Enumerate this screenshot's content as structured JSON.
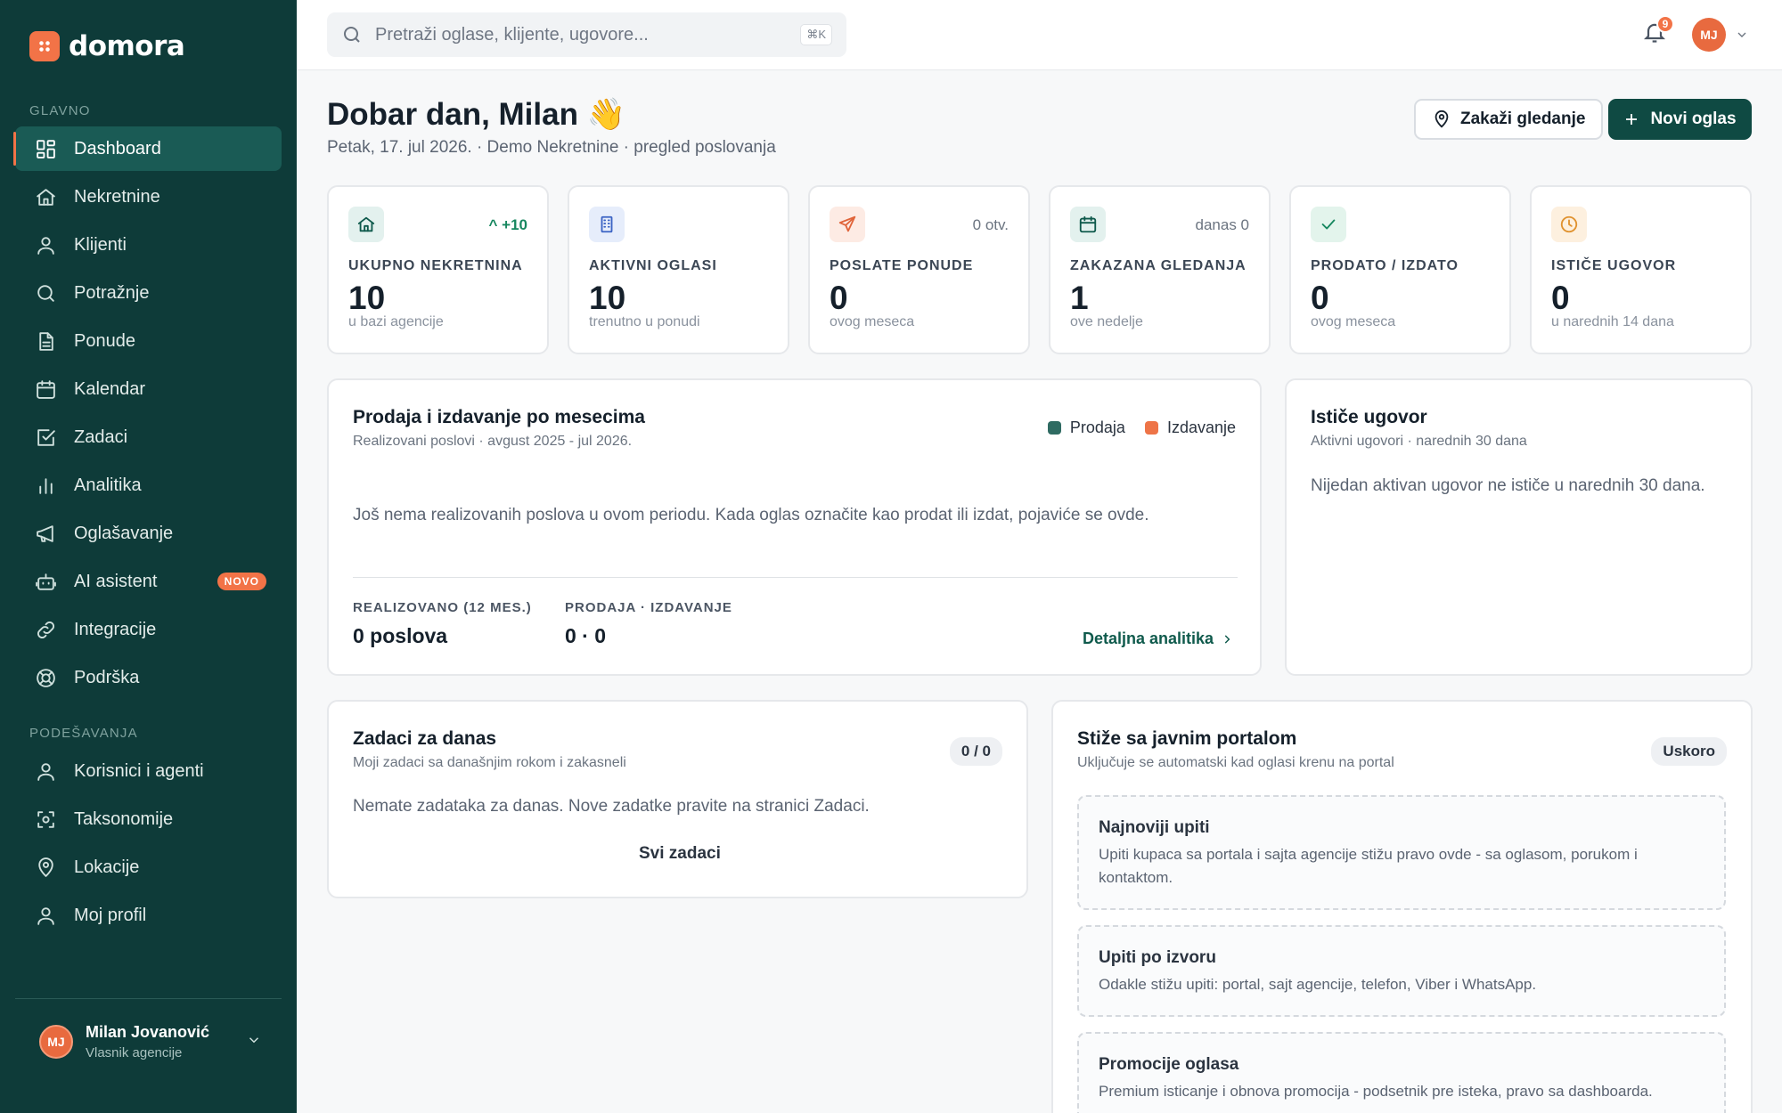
{
  "brand": {
    "name": "domora",
    "accent": "#f27347",
    "sidebar_bg": "#0e3b39",
    "primary": "#0f4a43"
  },
  "sidebar": {
    "section_main": "GLAVNO",
    "section_settings": "PODEŠAVANJA",
    "main_items": [
      {
        "label": "Dashboard",
        "icon": "dashboard-grid-icon",
        "active": true
      },
      {
        "label": "Nekretnine",
        "icon": "home-icon"
      },
      {
        "label": "Klijenti",
        "icon": "user-icon"
      },
      {
        "label": "Potražnje",
        "icon": "search-icon"
      },
      {
        "label": "Ponude",
        "icon": "document-icon"
      },
      {
        "label": "Kalendar",
        "icon": "calendar-icon"
      },
      {
        "label": "Zadaci",
        "icon": "checkbox-icon"
      },
      {
        "label": "Analitika",
        "icon": "bar-chart-icon"
      },
      {
        "label": "Oglašavanje",
        "icon": "megaphone-icon"
      },
      {
        "label": "AI asistent",
        "icon": "robot-icon",
        "badge": "NOVO"
      },
      {
        "label": "Integracije",
        "icon": "link-icon"
      },
      {
        "label": "Podrška",
        "icon": "lifebuoy-icon"
      }
    ],
    "settings_items": [
      {
        "label": "Korisnici i agenti",
        "icon": "users-icon"
      },
      {
        "label": "Taksonomije",
        "icon": "tag-scan-icon"
      },
      {
        "label": "Lokacije",
        "icon": "map-pin-icon"
      },
      {
        "label": "Moj profil",
        "icon": "profile-icon"
      }
    ],
    "user": {
      "initials": "MJ",
      "name": "Milan Jovanović",
      "role": "Vlasnik agencije"
    }
  },
  "topbar": {
    "search_placeholder": "Pretraži oglase, klijente, ugovore...",
    "search_shortcut": "⌘K",
    "notifications_count": "9",
    "avatar_initials": "MJ"
  },
  "header": {
    "greeting": "Dobar dan, Milan 👋",
    "subtitle": "Petak, 17. jul 2026. · Demo Nekretnine · pregled poslovanja",
    "schedule_button": "Zakaži gledanje",
    "new_listing_button": "Novi oglas"
  },
  "stats": [
    {
      "label": "UKUPNO NEKRETNINA",
      "value": "10",
      "hint": "u bazi agencije",
      "delta": "^ +10",
      "icon": "home-icon",
      "color": "#0f5a4c",
      "bg": "#e3f1ee"
    },
    {
      "label": "AKTIVNI OGLASI",
      "value": "10",
      "hint": "trenutno u ponudi",
      "delta": "",
      "icon": "building-icon",
      "color": "#3b63c4",
      "bg": "#e6edfb"
    },
    {
      "label": "POSLATE PONUDE",
      "value": "0",
      "hint": "ovog meseca",
      "delta": "0 otv.",
      "icon": "send-icon",
      "color": "#e0643a",
      "bg": "#fdebe4"
    },
    {
      "label": "ZAKAZANA GLEDANJA",
      "value": "1",
      "hint": "ove nedelje",
      "delta": "danas 0",
      "icon": "calendar-icon",
      "color": "#0f5a4c",
      "bg": "#e3f1ee"
    },
    {
      "label": "PRODATO / IZDATO",
      "value": "0",
      "hint": "ovog meseca",
      "delta": "",
      "icon": "check-icon",
      "color": "#17875f",
      "bg": "#e3f4ec"
    },
    {
      "label": "ISTIČE UGOVOR",
      "value": "0",
      "hint": "u narednih 14 dana",
      "delta": "",
      "icon": "clock-icon",
      "color": "#e0922f",
      "bg": "#fdf0df"
    }
  ],
  "sales_card": {
    "title": "Prodaja i izdavanje po mesecima",
    "subtitle": "Realizovani poslovi · avgust 2025 - jul 2026.",
    "legend": [
      {
        "name": "Prodaja",
        "color": "#2f6b62"
      },
      {
        "name": "Izdavanje",
        "color": "#ee7447"
      }
    ],
    "empty": "Još nema realizovanih poslova u ovom periodu. Kada oglas označite kao prodat ili izdat, pojaviće se ovde.",
    "realized_label": "REALIZOVANO (12 MES.)",
    "realized_value": "0 poslova",
    "split_label": "PRODAJA · IZDAVANJE",
    "split_value": "0 · 0",
    "link": "Detaljna analitika"
  },
  "contract_card": {
    "title": "Ističe ugovor",
    "subtitle": "Aktivni ugovori · narednih 30 dana",
    "empty": "Nijedan aktivan ugovor ne ističe u narednih 30 dana."
  },
  "tasks_card": {
    "title": "Zadaci za danas",
    "subtitle": "Moji zadaci sa današnjim rokom i zakasneli",
    "count": "0 / 0",
    "empty": "Nemate zadataka za danas. Nove zadatke pravite na stranici Zadaci.",
    "link": "Svi zadaci"
  },
  "portal_card": {
    "title": "Stiže sa javnim portalom",
    "subtitle": "Uključuje se automatski kad oglasi krenu na portal",
    "badge": "Uskoro",
    "items": [
      {
        "title": "Najnoviji upiti",
        "text": "Upiti kupaca sa portala i sajta agencije stižu pravo ovde - sa oglasom, porukom i kontaktom."
      },
      {
        "title": "Upiti po izvoru",
        "text": "Odakle stižu upiti: portal, sajt agencije, telefon, Viber i WhatsApp."
      },
      {
        "title": "Promocije oglasa",
        "text": "Premium isticanje i obnova promocija - podsetnik pre isteka, pravo sa dashboarda."
      }
    ]
  }
}
